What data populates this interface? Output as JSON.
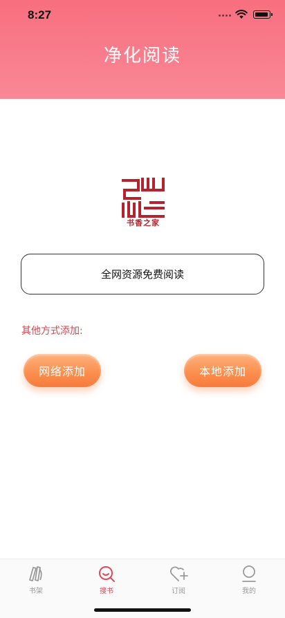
{
  "status_bar": {
    "time": "8:27"
  },
  "header": {
    "title": "净化阅读",
    "gradient_top": "#f86f7f",
    "gradient_bottom": "#f98896"
  },
  "logo": {
    "caption": "书香之家",
    "color": "#b5242e",
    "icon": "shuxiang-seal-logo"
  },
  "main": {
    "feature_button_label": "全网资源免费阅读",
    "other_methods_label": "其他方式添加:",
    "network_add_label": "网络添加",
    "local_add_label": "本地添加",
    "accent_orange": "#fb8d4c"
  },
  "tab_bar": {
    "active_color": "#e0495a",
    "inactive_color": "#9a9a9a",
    "items": [
      {
        "label": "书架",
        "icon": "bookshelf-icon",
        "active": false
      },
      {
        "label": "搜书",
        "icon": "search-icon",
        "active": true
      },
      {
        "label": "订阅",
        "icon": "heart-plus-icon",
        "active": false
      },
      {
        "label": "我的",
        "icon": "user-icon",
        "active": false
      }
    ]
  }
}
